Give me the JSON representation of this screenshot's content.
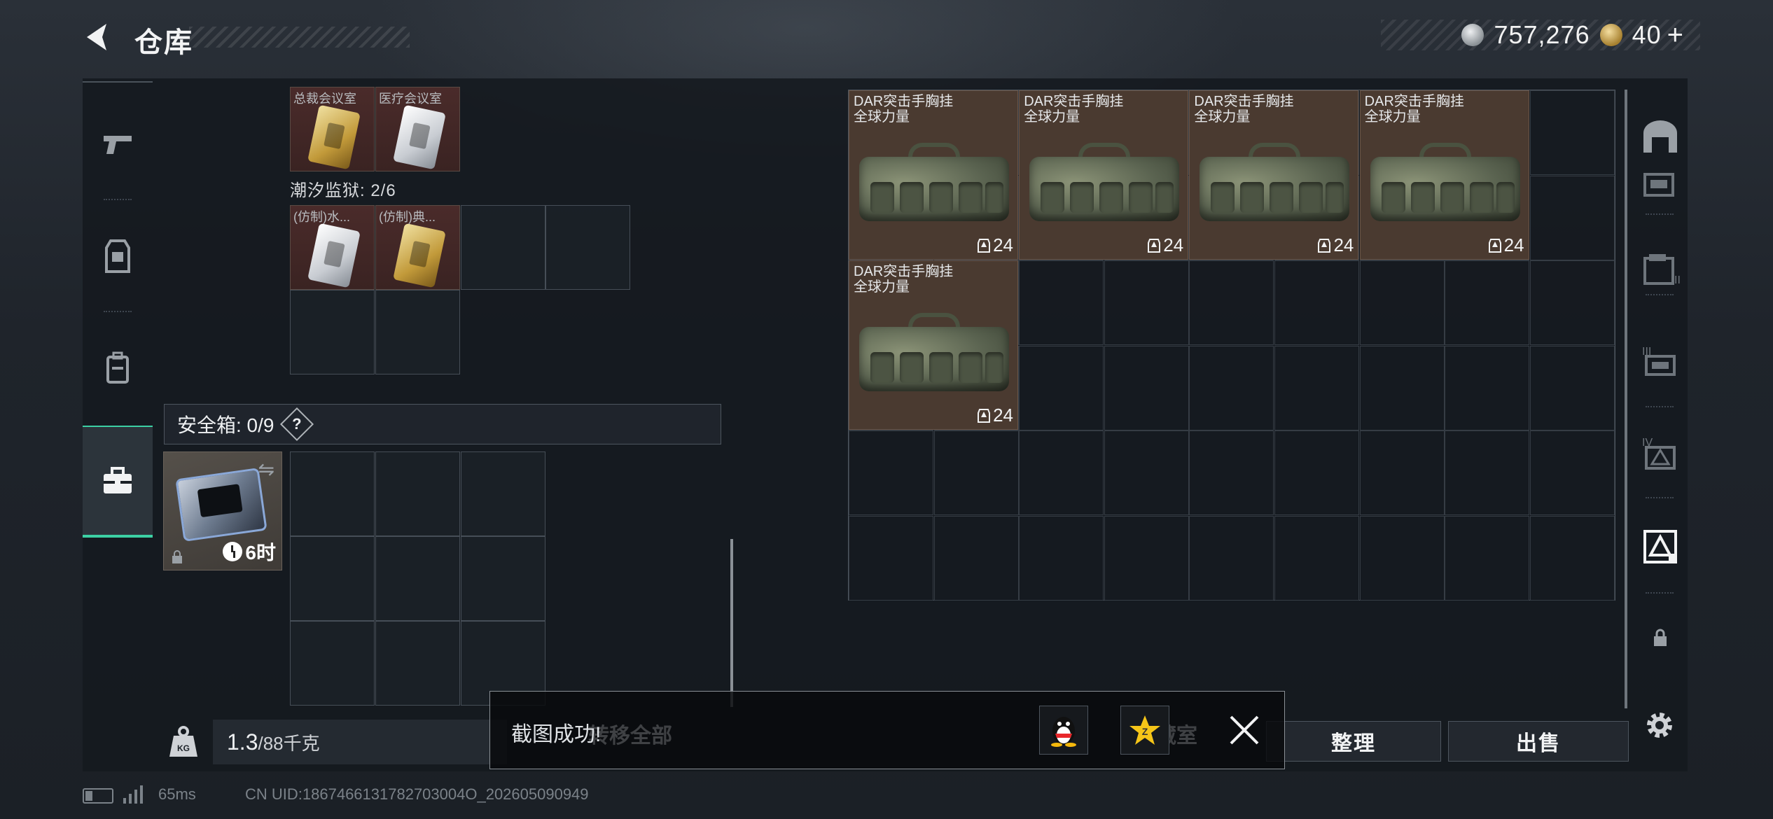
{
  "header": {
    "title": "仓库",
    "currency_silver": "757,276",
    "currency_gold": "40",
    "gold_plus": "+"
  },
  "left_nav": [
    "pistol-icon",
    "vest-icon",
    "backpack-icon",
    "briefcase-icon"
  ],
  "storage": {
    "keys_top": [
      {
        "label": "总裁会议室",
        "color": "gold"
      },
      {
        "label": "医疗会议室",
        "color": "silver"
      }
    ],
    "section_label": "潮汐监狱: 2/6",
    "keys_second": [
      {
        "label": "(仿制)水...",
        "color": "silver"
      },
      {
        "label": "(仿制)典...",
        "color": "gold"
      }
    ]
  },
  "safebox": {
    "title": "安全箱: 0/9",
    "help": "?",
    "timer": "6时"
  },
  "weight": {
    "current": "1.3",
    "max": "/88千克"
  },
  "vests": [
    {
      "name1": "DAR突击手胸挂",
      "name2": "全球力量",
      "count": "24"
    },
    {
      "name1": "DAR突击手胸挂",
      "name2": "全球力量",
      "count": "24"
    },
    {
      "name1": "DAR突击手胸挂",
      "name2": "全球力量",
      "count": "24"
    },
    {
      "name1": "DAR突击手胸挂",
      "name2": "全球力量",
      "count": "24"
    },
    {
      "name1": "DAR突击手胸挂",
      "name2": "全球力量",
      "count": "24"
    }
  ],
  "buttons": {
    "transfer_all": "转移全部",
    "hidden_room": "收藏室",
    "organize": "整理",
    "sell": "出售"
  },
  "toast": {
    "message": "截图成功!"
  },
  "status": {
    "ping": "65ms",
    "uid": "CN UID:1867466131782703004O_202605090949"
  }
}
